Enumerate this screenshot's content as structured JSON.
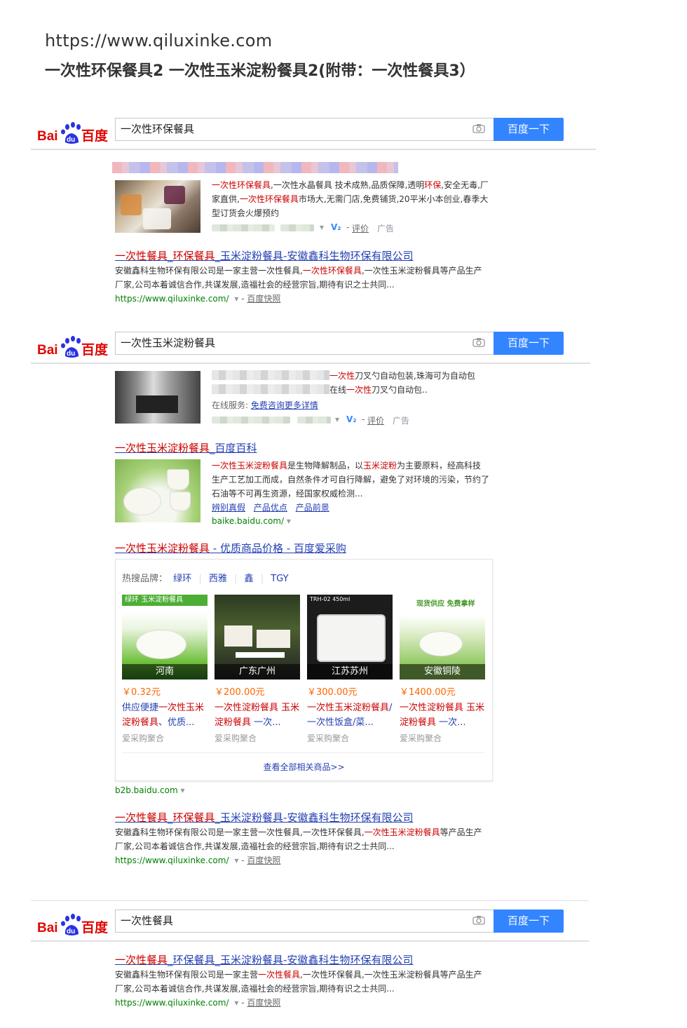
{
  "header": {
    "url": "https://www.qiluxinke.com",
    "title": "一次性环保餐具2   一次性玉米淀粉餐具2(附带：一次性餐具3）"
  },
  "colors": {
    "link": "#2440b3",
    "highlight": "#cc0000",
    "url_green": "#008000",
    "button_blue": "#3385ff",
    "price": "#ff6600"
  },
  "searches": [
    {
      "query": "一次性环保餐具",
      "button": "百度一下"
    },
    {
      "query": "一次性玉米淀粉餐具",
      "button": "百度一下"
    },
    {
      "query": "一次性餐具",
      "button": "百度一下"
    }
  ],
  "logo_text": {
    "a": "Bai",
    "b": "du",
    "c": "百度"
  },
  "ad1": {
    "snippet_hl": "一次性环保餐具",
    "snippet_1": ",一次性水晶餐具 技术成熟,品质保障,透明",
    "snippet_hl2": "环保",
    "snippet_2": ",安全无毒,厂家直供,",
    "snippet_hl3": "一次性环保餐具",
    "snippet_3": "市场大,无需门店,免费铺货,20平米小本创业,春季大型订货会火爆预约",
    "v_badge": "V₂",
    "review": "评价",
    "ad_label": "广告"
  },
  "result1": {
    "t1": "一次性",
    "t2": "餐具",
    "t3": "_",
    "t4": "环保餐具",
    "t5": "_玉米淀粉餐具-安徽鑫科生物环保有限公司",
    "s1": "安徽鑫科生物环保有限公司是一家主营一次性餐具,",
    "s_hl": "一次性环保餐具",
    "s2": ",一次性玉米淀粉餐具等产品生产厂家,公司本着诚信合作,共谋发展,造福社会的经营宗旨,期待有识之士共同...",
    "url": "https://www.qiluxinke.com/",
    "cache": "百度快照"
  },
  "ad2": {
    "l1_hl": "一次性",
    "l1": "刀叉勺自动包装,珠海可为自动包",
    "l2a": "在线",
    "l2_hl": "一次性",
    "l2b": "刀叉勺自动包..",
    "service_label": "在线服务:",
    "service_link": "免费咨询更多详情",
    "v_badge": "V₂",
    "review": "评价",
    "ad_label": "广告"
  },
  "baike": {
    "title_hl": "一次性玉米淀粉餐具",
    "title_rest": "_百度百科",
    "s_hl": "一次性玉米淀粉餐具",
    "s1": "是生物降解制品，以",
    "s_hl2": "玉米淀粉",
    "s2": "为主要原料，经高科技生产工艺加工而成，自然条件才可自行降解，避免了对环境的污染，节约了石油等不可再生资源，经国家权威检测...",
    "links": [
      "辨别真假",
      "产品优点",
      "产品前景"
    ],
    "url": "baike.baidu.com/"
  },
  "b2b": {
    "title_hl": "一次性玉米淀粉餐具",
    "title_rest": " - 优质商品价格 - 百度爱采购",
    "brands_label": "热搜品牌：",
    "brands": [
      "绿环",
      "西雅",
      "鑫",
      "TGY"
    ],
    "products": [
      {
        "cap": "河南",
        "price": "￥0.32元",
        "d1": "供应便捷",
        "d_hl": "一次性玉米淀粉餐具",
        "d2": "、优质...",
        "src": "爱采购聚合",
        "img_text": "绿环 玉米淀粉餐具"
      },
      {
        "cap": "广东广州",
        "price": "￥200.00元",
        "d1": "",
        "d_hl": "一次性淀粉餐具 玉米淀粉餐具",
        "d2": " 一次...",
        "src": "爱采购聚合",
        "img_text": ""
      },
      {
        "cap": "江苏苏州",
        "price": "￥300.00元",
        "d1": "",
        "d_hl": "一次性玉米淀粉餐具",
        "d2": "/一次性饭盒/菜...",
        "src": "爱采购聚合",
        "img_text": "TRH-02 450ml"
      },
      {
        "cap": "安徽铜陵",
        "price": "￥1400.00元",
        "d1": "",
        "d_hl": "一次性淀粉餐具 玉米淀粉餐具",
        "d2": " 一次...",
        "src": "爱采购聚合",
        "img_text": "现货供应 免费拿样"
      }
    ],
    "see_all": "查看全部相关商品>>",
    "url": "b2b.baidu.com"
  },
  "result2": {
    "t1": "一次性",
    "t2": "餐具",
    "t3": "_",
    "t4": "环保餐具",
    "t5": "_玉米淀粉餐具-安徽鑫科生物环保有限公司",
    "s1": "安徽鑫科生物环保有限公司是一家主营一次性餐具,一次性环保餐具,",
    "s_hl": "一次性玉米淀粉餐具",
    "s2": "等产品生产厂家,公司本着诚信合作,共谋发展,造福社会的经营宗旨,期待有识之士共同...",
    "url": "https://www.qiluxinke.com/",
    "cache": "百度快照"
  },
  "result3": {
    "t1": "一次性餐具",
    "t2": "_环保餐具_玉米淀粉餐具-安徽鑫科生物环保有限公司",
    "s1": "安徽鑫科生物环保有限公司是一家主营",
    "s_hl": "一次性餐具",
    "s2": ",一次性环保餐具,一次性玉米淀粉餐具等产品生产厂家,公司本着诚信合作,共谋发展,造福社会的经营宗旨,期待有识之士共同...",
    "url": "https://www.qiluxinke.com/",
    "cache": "百度快照"
  }
}
